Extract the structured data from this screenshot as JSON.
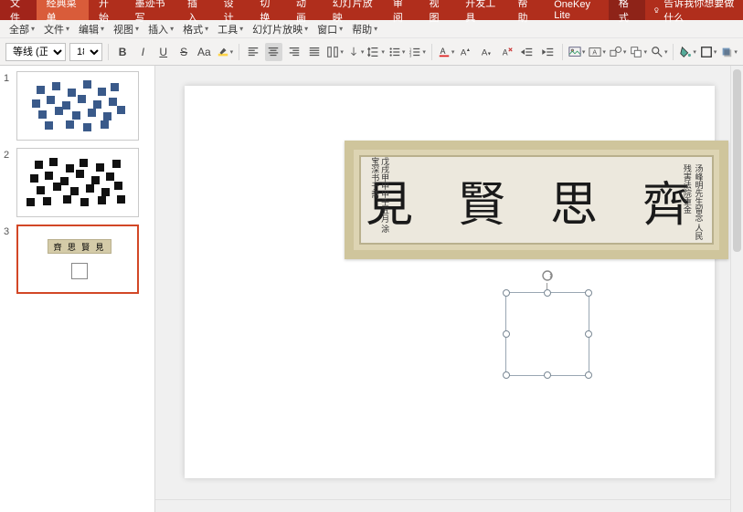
{
  "ribbon": {
    "file": "文件",
    "classic": "经典菜单",
    "home": "开始",
    "ink": "墨迹书写",
    "insert": "插入",
    "design": "设计",
    "transitions": "切换",
    "animations": "动画",
    "slideshow": "幻灯片放映",
    "review": "审阅",
    "view": "视图",
    "developer": "开发工具",
    "help": "帮助",
    "onekey": "OneKey Lite",
    "format": "格式",
    "tellme": "告诉我你想要做什么"
  },
  "menu": {
    "all": "全部",
    "file": "文件",
    "edit": "编辑",
    "view": "视图",
    "insert": "插入",
    "format": "格式",
    "tools": "工具",
    "slideshow": "幻灯片放映",
    "window": "窗口",
    "help": "帮助"
  },
  "toolbar": {
    "font_name": "等线 (正文)",
    "font_size": "18",
    "bold": "B",
    "italic": "I",
    "underline": "U",
    "strike": "S",
    "caseToggle": "Aa",
    "superscript": "A",
    "subscript": "A"
  },
  "thumbs": {
    "n1": "1",
    "n2": "2",
    "n3": "3",
    "banner_mini": "齊 思 賢 見"
  },
  "slide": {
    "banner_text": "見 賢 思 齊",
    "seal_text": "戊戌甲申甲壬五月 涂宝深书于斋",
    "side_text": "汤峰明先生留念 人民残害法院重金"
  }
}
